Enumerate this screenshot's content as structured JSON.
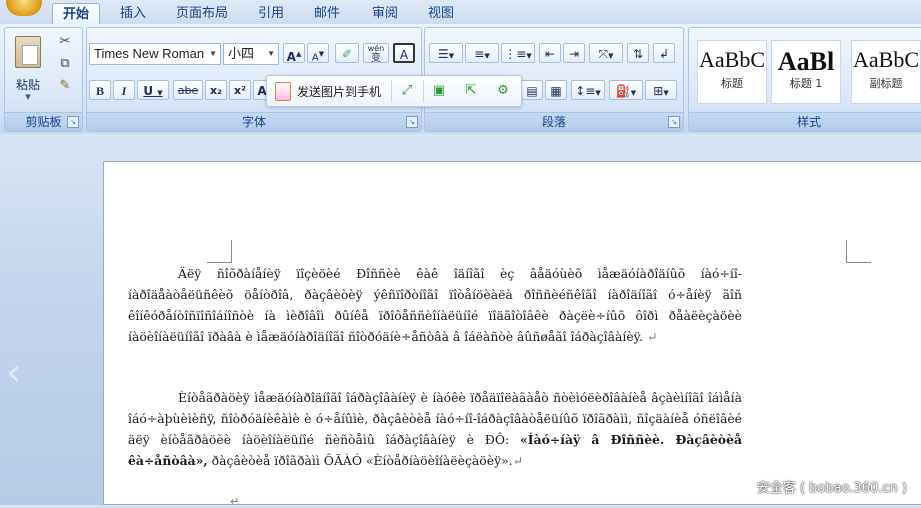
{
  "tabs": [
    "开始",
    "插入",
    "页面布局",
    "引用",
    "邮件",
    "审阅",
    "视图"
  ],
  "ribbon": {
    "clipboard": {
      "group_label": "剪贴板",
      "paste_label": "粘贴"
    },
    "font": {
      "group_label": "字体",
      "font_name": "Times New Roman",
      "font_size": "小四",
      "bold": "B",
      "italic": "I",
      "underline": "U",
      "strike": "abe",
      "subscript": "x₂",
      "superscript": "x²",
      "text_effect": "A",
      "wen": "wén",
      "bian": "变",
      "border_a": "A",
      "grow": "A",
      "shrink": "A",
      "clear": "A"
    },
    "paragraph": {
      "group_label": "段落"
    },
    "styles": {
      "group_label": "样式",
      "cards": [
        {
          "sample": "AaBbC",
          "name": "标题"
        },
        {
          "sample": "AaBl",
          "name": "标题 1"
        },
        {
          "sample": "AaBbC",
          "name": "副标题"
        }
      ]
    }
  },
  "float_toolbar": {
    "send_label": "发送图片到手机"
  },
  "document": {
    "paragraph1": "Äëÿ ñîõðàíåíèÿ ïîçèöèé Ðîññèè êàê îäíîãî èç âåäóùèõ ìåæäóíàðîäíûõ íàó÷íî-íàðîäåàòåëüñêèõ öåíòðîâ, ðàçâèòèÿ ýêñïîðòíîãî ïîòåíöèàëà ðîññèéñêîãî íàðîäíîãî ó÷åíèÿ ãîñ êîíêóðåíòîñïîñîáíîñòè íà ìèðîâîì ðûíêå ïðîôåññèîíàëüíîé ïîäãîòîâêè ðàçëè÷íûõ ôîðì ðåàëèçàöèè íàöèîíàëüíîãî ïðàâà è ìåæäóíàðîäíîãî ñîòðóäíè÷åñòâà â îáëàñòè âûñøåãî îáðàçîâàíèÿ.",
    "paragraph2_plain": "Èíòåãðàöèÿ ìåæäóíàðîäíîãî îáðàçîâàíèÿ è íàóêè ïðåäïîëàãàåò ñòèìóëèðîâàíèå âçàèìíîãî îáìåíà îáó÷àþùèìèñÿ, ñîòðóäíèêàìè è ó÷åíûìè, ðàçâèòèå íàó÷íî-îáðàçîâàòåëüíûõ ïðîãðàìì, ñîçäàíèå óñëîâèé äëÿ èíòåãðàöèè íàöèîíàëüíîé ñèñòåìû îáðàçîâàíèÿ è ÐÔ:",
    "paragraph2_bold": "«Íàó÷íàÿ â Ðîññèè. Ðàçâèòèå êà÷åñòâà»,",
    "paragraph2_tail": "ðàçâèòèå ïðîãðàìì ÔÃÀÓ «Èíòåðíàöèîíàëèçàöèÿ».",
    "pilcrow": "↵"
  },
  "watermark": "安全客 ( bobao.360.cn )"
}
